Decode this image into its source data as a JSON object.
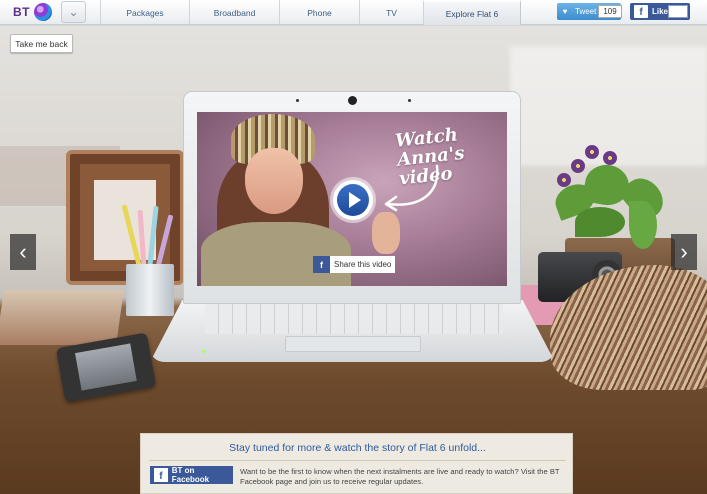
{
  "header": {
    "logo_text": "BT",
    "nav": [
      {
        "label": "Packages"
      },
      {
        "label": "Broadband"
      },
      {
        "label": "Phone"
      },
      {
        "label": "TV"
      },
      {
        "label": "Explore Flat 6"
      }
    ],
    "active_tab": "Explore Flat 6",
    "tweet_label": "Tweet",
    "tweet_count": "109",
    "like_label": "Like"
  },
  "scene": {
    "back_label": "Take me back",
    "video_caption": "Watch Anna's video",
    "share_label": "Share this video"
  },
  "info": {
    "title": "Stay tuned for more & watch the story of Flat 6 unfold...",
    "fb_button_label": "BT on Facebook",
    "text": "Want to be the first to know when the next instalments are live and ready to watch? Visit the BT Facebook page and join us to receive regular updates."
  },
  "colors": {
    "brand_purple": "#5b2d90",
    "link_blue": "#2d5a9a",
    "facebook_blue": "#3b5998",
    "twitter_blue": "#55acee"
  },
  "icons": [
    "bt-globe-icon",
    "chevron-double-down-icon",
    "twitter-bird-icon",
    "facebook-f-icon",
    "play-icon",
    "chevron-left-icon",
    "chevron-right-icon"
  ]
}
